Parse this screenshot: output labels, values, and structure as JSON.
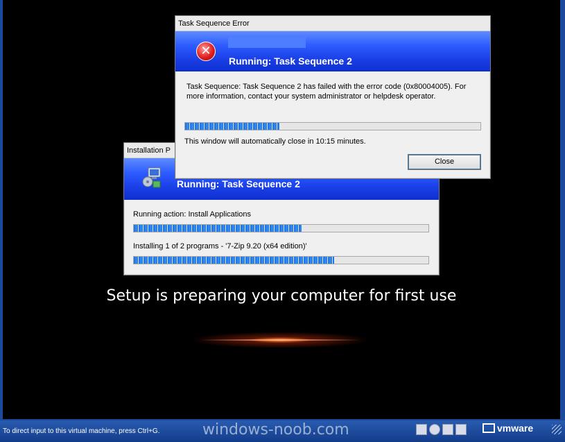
{
  "setup": {
    "message": "Setup is preparing your computer for first use"
  },
  "install_window": {
    "title": "Installation P",
    "banner_title": "Running: Task Sequence 2",
    "running_action": "Running action: Install Applications",
    "action_progress": 0.57,
    "installing_text": "Installing 1 of 2 programs - '7-Zip 9.20 (x64 edition)'",
    "install_progress": 0.68
  },
  "error_window": {
    "title": "Task Sequence Error",
    "banner_title": "Running: Task Sequence 2",
    "message_line1": "Task Sequence: Task Sequence 2 has failed with the error code  (0x80004005). For",
    "message_line2": "more information, contact your system administrator or helpdesk operator.",
    "countdown_progress": 0.32,
    "countdown_text": "This window will automatically close in 10:15 minutes.",
    "close_label": "Close",
    "icon_glyph": "✕"
  },
  "status_bar": {
    "text": "To direct input to this virtual machine, press Ctrl+G.",
    "watermark": "windows-noob.com",
    "brand": "vmware"
  }
}
